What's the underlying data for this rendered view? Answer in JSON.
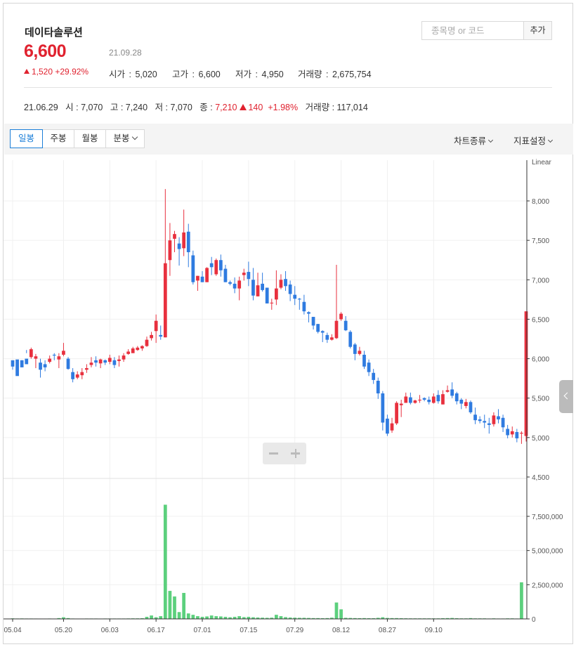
{
  "stock": {
    "name": "데이타솔루션",
    "price": "6,600",
    "date": "21.09.28",
    "change_amount": "1,520",
    "change_pct": "+29.92%",
    "open_label": "시가",
    "open": "5,020",
    "high_label": "고가",
    "high": "6,600",
    "low_label": "저가",
    "low": "4,950",
    "volume_label": "거래량",
    "volume": "2,675,754"
  },
  "search": {
    "placeholder": "종목명 or 코드",
    "add_label": "추가"
  },
  "history": {
    "date": "21.06.29",
    "open_label": "시",
    "open": "7,070",
    "high_label": "고",
    "high": "7,240",
    "low_label": "저",
    "low": "7,070",
    "close_label": "종",
    "close": "7,210",
    "change": "140",
    "change_pct": "+1.98%",
    "volume_label": "거래량",
    "volume": "117,014"
  },
  "toolbar": {
    "tabs": [
      "일봉",
      "주봉",
      "월봉",
      "분봉"
    ],
    "active_tab": "일봉",
    "chart_type_label": "차트종류",
    "indicator_label": "지표설정"
  },
  "colors": {
    "up": "#e8303e",
    "down": "#2f7be0",
    "volume": "#5cd07d",
    "accent": "#1c7fd8"
  },
  "chart_data": {
    "type": "candlestick",
    "scale_label": "Linear",
    "price_ylim": [
      4500,
      8000
    ],
    "price_ticks": [
      "8,000",
      "7,500",
      "7,000",
      "6,500",
      "6,000",
      "5,500",
      "5,000",
      "4,500"
    ],
    "volume_ticks": [
      "7,500,000",
      "5,000,000",
      "2,500,000",
      "0"
    ],
    "x_ticks": [
      "05.04",
      "05.20",
      "06.03",
      "06.17",
      "07.01",
      "07.15",
      "07.29",
      "08.12",
      "08.27",
      "09.10"
    ],
    "x_tick_index": [
      0,
      11,
      21,
      31,
      41,
      51,
      61,
      71,
      81,
      91
    ],
    "candles": [
      [
        5980,
        5900,
        5960,
        5860
      ],
      [
        5990,
        5780,
        5920,
        5880
      ],
      [
        5980,
        5890,
        5980,
        5900
      ],
      [
        6000,
        5930,
        6110,
        6070
      ],
      [
        6020,
        6120,
        6140,
        6000
      ],
      [
        6000,
        6030,
        6060,
        5880
      ],
      [
        5950,
        5860,
        6000,
        5760
      ],
      [
        5930,
        5890,
        5980,
        5840
      ],
      [
        5960,
        6000,
        6040,
        5940
      ],
      [
        6050,
        6040,
        6070,
        5980
      ],
      [
        5990,
        6030,
        6070,
        5880
      ],
      [
        6050,
        6100,
        6200,
        6030
      ],
      [
        6000,
        5870,
        6020,
        5860
      ],
      [
        5830,
        5740,
        5880,
        5700
      ],
      [
        5760,
        5800,
        5840,
        5740
      ],
      [
        5790,
        5830,
        5880,
        5740
      ],
      [
        5860,
        5880,
        5930,
        5820
      ],
      [
        5920,
        5950,
        6020,
        5890
      ],
      [
        5980,
        5950,
        6030,
        5900
      ],
      [
        5940,
        5990,
        6000,
        5880
      ],
      [
        5980,
        5950,
        5990,
        5920
      ],
      [
        5960,
        6010,
        6050,
        5930
      ],
      [
        5980,
        5920,
        6020,
        5880
      ],
      [
        5970,
        5990,
        6040,
        5900
      ],
      [
        5990,
        6040,
        6070,
        5960
      ],
      [
        6060,
        6090,
        6120,
        6050
      ],
      [
        6070,
        6130,
        6150,
        6080
      ],
      [
        6110,
        6140,
        6160,
        6100
      ],
      [
        6130,
        6160,
        6170,
        6100
      ],
      [
        6160,
        6240,
        6280,
        6150
      ],
      [
        6260,
        6300,
        6340,
        6230
      ],
      [
        6350,
        6480,
        6560,
        6200
      ],
      [
        6300,
        6280,
        6420,
        6240
      ],
      [
        6270,
        7210,
        8150,
        6270
      ],
      [
        7250,
        7500,
        7720,
        7050
      ],
      [
        7520,
        7580,
        7620,
        7350
      ],
      [
        7460,
        7390,
        7540,
        7180
      ],
      [
        7400,
        7600,
        7890,
        7300
      ],
      [
        7610,
        7350,
        7710,
        7160
      ],
      [
        7310,
        6970,
        7370,
        6940
      ],
      [
        6990,
        7050,
        7050,
        6860
      ],
      [
        7040,
        6970,
        7110,
        6970
      ],
      [
        6970,
        7150,
        7160,
        6970
      ],
      [
        7210,
        7160,
        7290,
        7060
      ],
      [
        7070,
        7250,
        7270,
        7050
      ],
      [
        7250,
        7120,
        7320,
        7040
      ],
      [
        7140,
        6970,
        7190,
        6970
      ],
      [
        6970,
        6950,
        6990,
        6930
      ],
      [
        6950,
        6890,
        7030,
        6830
      ],
      [
        6890,
        6990,
        7040,
        6740
      ],
      [
        7060,
        7090,
        7140,
        6990
      ],
      [
        7100,
        7010,
        7230,
        6920
      ],
      [
        7000,
        6800,
        7150,
        6740
      ],
      [
        6790,
        6930,
        7090,
        6790
      ],
      [
        6950,
        6870,
        7090,
        6850
      ],
      [
        6900,
        6700,
        6900,
        6700
      ],
      [
        6710,
        6710,
        6760,
        6620
      ],
      [
        6750,
        6890,
        7120,
        6680
      ],
      [
        6900,
        7000,
        7070,
        6880
      ],
      [
        7010,
        6920,
        7110,
        6860
      ],
      [
        6940,
        6820,
        6990,
        6730
      ],
      [
        6810,
        6760,
        6920,
        6680
      ],
      [
        6760,
        6750,
        6770,
        6620
      ],
      [
        6720,
        6600,
        6810,
        6560
      ],
      [
        6590,
        6570,
        6600,
        6460
      ],
      [
        6530,
        6420,
        6530,
        6370
      ],
      [
        6440,
        6340,
        6440,
        6320
      ],
      [
        6350,
        6330,
        6360,
        6210
      ],
      [
        6300,
        6240,
        6330,
        6200
      ],
      [
        6240,
        6270,
        6310,
        6230
      ],
      [
        6260,
        6480,
        7190,
        6250
      ],
      [
        6500,
        6570,
        6590,
        6480
      ],
      [
        6480,
        6360,
        6540,
        6350
      ],
      [
        6340,
        6150,
        6360,
        6130
      ],
      [
        6180,
        6060,
        6200,
        5980
      ],
      [
        6060,
        6100,
        6150,
        6040
      ],
      [
        6050,
        5900,
        6100,
        5870
      ],
      [
        5950,
        5830,
        5990,
        5780
      ],
      [
        5820,
        5730,
        5870,
        5680
      ],
      [
        5720,
        5560,
        5760,
        5490
      ],
      [
        5560,
        5190,
        5590,
        5090
      ],
      [
        5240,
        5050,
        5290,
        5020
      ],
      [
        5090,
        5180,
        5250,
        5060
      ],
      [
        5180,
        5440,
        5460,
        5160
      ],
      [
        5410,
        5430,
        5480,
        5260
      ],
      [
        5440,
        5520,
        5570,
        5440
      ],
      [
        5510,
        5440,
        5570,
        5420
      ],
      [
        5440,
        5470,
        5480,
        5430
      ],
      [
        5470,
        5480,
        5540,
        5440
      ],
      [
        5500,
        5480,
        5510,
        5460
      ]
    ],
    "candles_tail": [
      [
        5480,
        5450,
        5520,
        5420
      ],
      [
        5440,
        5520,
        5560,
        5430
      ],
      [
        5540,
        5460,
        5600,
        5430
      ],
      [
        5420,
        5550,
        5600,
        5420
      ],
      [
        5580,
        5600,
        5660,
        5570
      ],
      [
        5610,
        5530,
        5700,
        5500
      ],
      [
        5560,
        5460,
        5580,
        5420
      ],
      [
        5480,
        5430,
        5500,
        5360
      ],
      [
        5400,
        5450,
        5490,
        5370
      ],
      [
        5450,
        5320,
        5470,
        5300
      ],
      [
        5290,
        5220,
        5380,
        5170
      ],
      [
        5230,
        5210,
        5270,
        5180
      ],
      [
        5210,
        5190,
        5290,
        5120
      ],
      [
        5180,
        5160,
        5250,
        5050
      ],
      [
        5170,
        5280,
        5320,
        5140
      ],
      [
        5270,
        5230,
        5360,
        5180
      ],
      [
        5250,
        5130,
        5290,
        5070
      ],
      [
        5110,
        5030,
        5160,
        4990
      ],
      [
        5040,
        5080,
        5140,
        5000
      ],
      [
        5070,
        4990,
        5110,
        4940
      ],
      [
        5050,
        5060,
        5080,
        4920
      ],
      [
        5020,
        6600,
        6600,
        4950
      ]
    ],
    "volumes": [
      40000,
      30000,
      35000,
      30000,
      30000,
      28000,
      25000,
      25000,
      30000,
      25000,
      60000,
      120000,
      60000,
      30000,
      25000,
      25000,
      30000,
      30000,
      30000,
      25000,
      30000,
      30000,
      30000,
      30000,
      30000,
      35000,
      40000,
      40000,
      50000,
      150000,
      250000,
      120000,
      200000,
      8350000,
      2050000,
      1640000,
      500000,
      1900000,
      400000,
      300000,
      200000,
      150000,
      180000,
      250000,
      200000,
      180000,
      150000,
      120000,
      150000,
      200000,
      130000,
      150000,
      120000,
      100000,
      90000,
      80000,
      90000,
      300000,
      200000,
      130000,
      100000,
      90000,
      80000,
      80000,
      70000,
      60000,
      60000,
      50000,
      60000,
      90000,
      1200000,
      700000,
      80000,
      70000,
      60000,
      55000,
      60000,
      50000,
      50000,
      80000,
      120000,
      70000,
      60000,
      60000,
      50000,
      45000,
      40000,
      40000,
      40000,
      40000,
      40000,
      40000,
      40000,
      50000,
      60000,
      70000,
      50000,
      40000,
      40000,
      60000,
      40000,
      40000,
      40000,
      30000,
      40000,
      30000,
      30000,
      40000,
      40000,
      30000,
      2675754
    ]
  }
}
